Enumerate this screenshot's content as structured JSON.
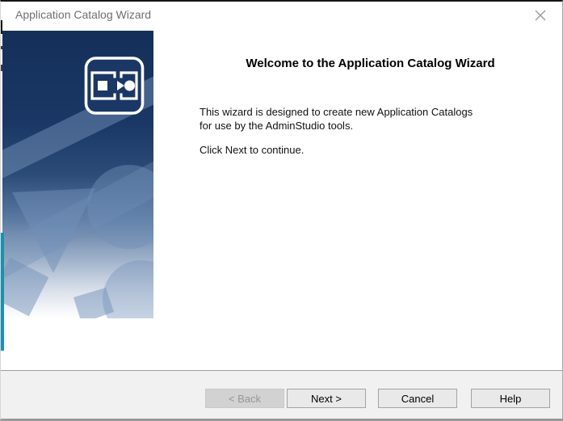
{
  "window": {
    "title": "Application Catalog Wizard"
  },
  "sidebar": {
    "logo_icon": "application-catalog-conversion-icon"
  },
  "content": {
    "heading": "Welcome to the Application Catalog Wizard",
    "body_line1": "This wizard is designed to create new Application Catalogs",
    "body_line2": "for use by the AdminStudio tools.",
    "note": "Click Next to continue."
  },
  "footer": {
    "buttons": [
      {
        "label": "< Back",
        "enabled": false
      },
      {
        "label": "Next >",
        "enabled": true
      },
      {
        "label": "Cancel",
        "enabled": true
      },
      {
        "label": "Help",
        "enabled": true
      }
    ]
  },
  "colors": {
    "sidebar_navy": "#16335f",
    "sidebar_shape_blue": "#7290b8",
    "left_accent_teal": "#1f8fad",
    "footer_bg": "#f1f1f1",
    "button_bg": "#e9e9e9",
    "button_border": "#a3a3a3",
    "disabled_button_bg": "#d2d2d2",
    "disabled_button_text": "#969696",
    "title_text": "#6f6f6f",
    "top_border": "#161616"
  }
}
